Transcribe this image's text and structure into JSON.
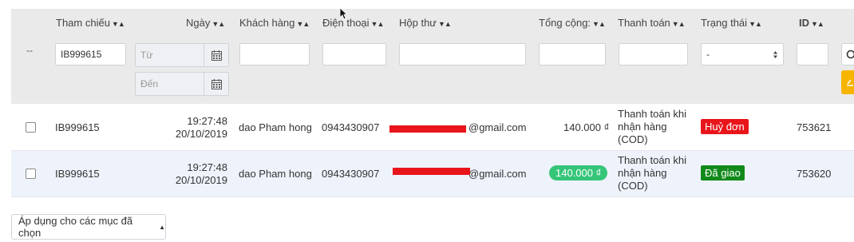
{
  "headers": {
    "reference": "Tham chiếu",
    "date": "Ngày",
    "customer": "Khách hàng",
    "phone": "Điện thoại",
    "mailbox": "Hộp thư",
    "total": "Tổng cộng:",
    "payment": "Thanh toán",
    "status": "Trạng thái",
    "id": "ID"
  },
  "sort_glyph": "▼▲",
  "filters": {
    "dash": "--",
    "reference_value": "IB999615",
    "date_from_placeholder": "Từ",
    "date_to_placeholder": "Đến",
    "status_selected": "-"
  },
  "rows": [
    {
      "reference": "IB999615",
      "time": "19:27:48",
      "date": "20/10/2019",
      "customer": "dao Pham hong",
      "phone": "0943430907",
      "email_visible": "@gmail.com",
      "total": "140.000 ₫",
      "payment_line1": "Thanh toán khi",
      "payment_line2": "nhận hàng",
      "payment_line3": "(COD)",
      "status": "Huỷ đơn",
      "status_color": "#e8151b",
      "id": "753621"
    },
    {
      "reference": "IB999615",
      "time": "19:27:48",
      "date": "20/10/2019",
      "customer": "dao Pham hong",
      "phone": "0943430907",
      "email_visible": "@gmail.com",
      "total": "140.000 ₫",
      "payment_line1": "Thanh toán khi",
      "payment_line2": "nhận hàng",
      "payment_line3": "(COD)",
      "status": "Đã giao",
      "status_color": "#118a1b",
      "id": "753620"
    }
  ],
  "bulk_action": {
    "label": "Áp dụng cho các mục đã chọn",
    "caret": "▲"
  },
  "colors": {
    "filter_bg": "#eaeaea",
    "row_highlight": "#eef3fb",
    "total_pill": "#35c579",
    "action_yellow": "#f7b500",
    "redaction": "#e8151b"
  }
}
